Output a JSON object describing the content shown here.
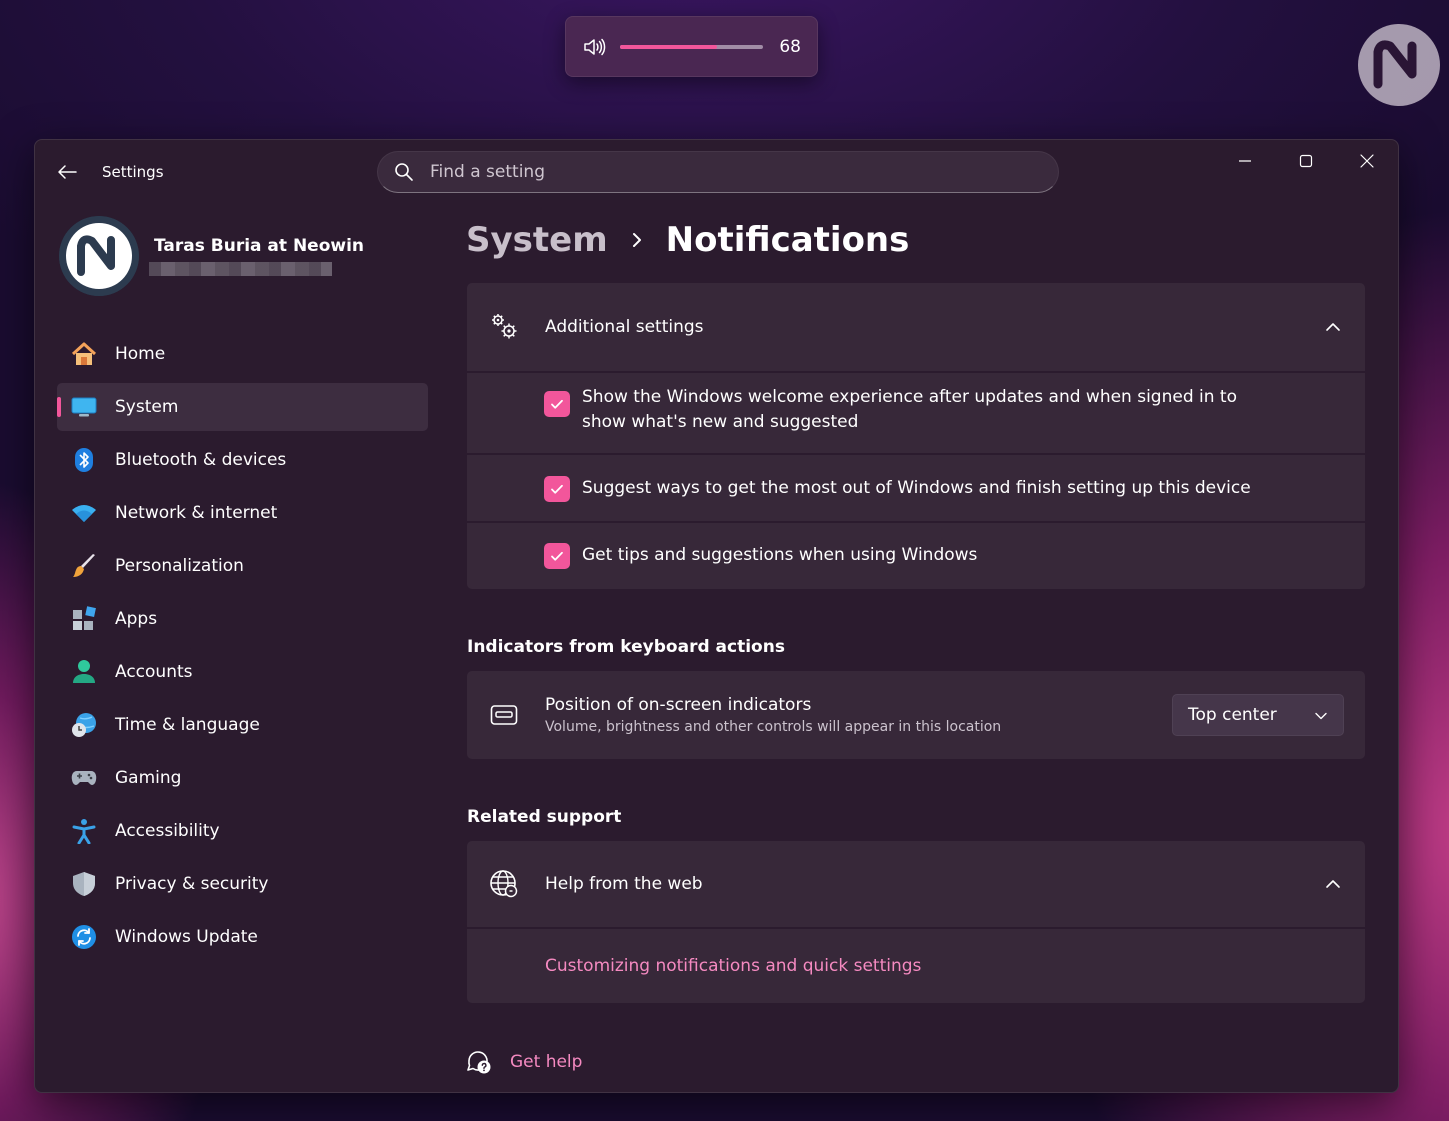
{
  "volume_flyout": {
    "value": "68",
    "level_percent": 68,
    "icon": "speaker-icon"
  },
  "window": {
    "title": "Settings",
    "search": {
      "placeholder": "Find a setting"
    },
    "controls": [
      "minimize-icon",
      "maximize-icon",
      "close-icon"
    ]
  },
  "profile": {
    "name": "Taras Buria at Neowin"
  },
  "sidebar": {
    "items": [
      {
        "label": "Home",
        "icon": "home-icon",
        "active": false
      },
      {
        "label": "System",
        "icon": "monitor-icon",
        "active": true
      },
      {
        "label": "Bluetooth & devices",
        "icon": "bluetooth-icon",
        "active": false
      },
      {
        "label": "Network & internet",
        "icon": "wifi-icon",
        "active": false
      },
      {
        "label": "Personalization",
        "icon": "brush-icon",
        "active": false
      },
      {
        "label": "Apps",
        "icon": "apps-icon",
        "active": false
      },
      {
        "label": "Accounts",
        "icon": "person-icon",
        "active": false
      },
      {
        "label": "Time & language",
        "icon": "globe-clock-icon",
        "active": false
      },
      {
        "label": "Gaming",
        "icon": "gamepad-icon",
        "active": false
      },
      {
        "label": "Accessibility",
        "icon": "accessibility-icon",
        "active": false
      },
      {
        "label": "Privacy & security",
        "icon": "shield-icon",
        "active": false
      },
      {
        "label": "Windows Update",
        "icon": "update-icon",
        "active": false
      }
    ]
  },
  "breadcrumb": {
    "parent": "System",
    "current": "Notifications"
  },
  "additional_settings": {
    "title": "Additional settings",
    "checkboxes": [
      {
        "label": "Show the Windows welcome experience after updates and when signed in to show what's new and suggested",
        "checked": true
      },
      {
        "label": "Suggest ways to get the most out of Windows and finish setting up this device",
        "checked": true
      },
      {
        "label": "Get tips and suggestions when using Windows",
        "checked": true
      }
    ]
  },
  "indicators": {
    "section_title": "Indicators from keyboard actions",
    "setting": {
      "title": "Position of on-screen indicators",
      "description": "Volume, brightness and other controls will appear in this location",
      "selected": "Top center"
    }
  },
  "related_support": {
    "section_title": "Related support",
    "expander_title": "Help from the web",
    "link": "Customizing notifications and quick settings"
  },
  "get_help": {
    "label": "Get help"
  },
  "colors": {
    "accent": "#f2569b",
    "link": "#f58ac1",
    "card": "#372839",
    "window": "#2b1b2e"
  }
}
